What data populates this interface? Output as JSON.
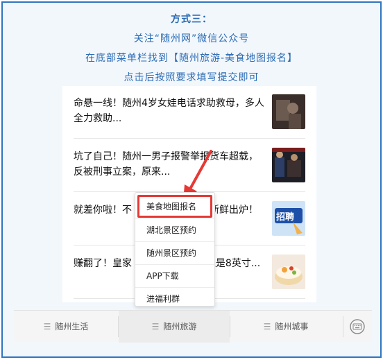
{
  "instructions": {
    "title": "方式三：",
    "line1": "关注“随州网”微信公众号",
    "line2": "在底部菜单栏找到【随州旅游-美食地图报名】",
    "line3": "点击后按照要求填写提交即可"
  },
  "articles": [
    {
      "headline": "命悬一线！随州4岁女娃电话求助救母，多人全力救助...",
      "thumb_icon": "photo-thumbnail-icon"
    },
    {
      "headline": "坑了自己！随州一男子报警举报货车超载，反被刑事立案，原来...",
      "thumb_icon": "police-photo-icon"
    },
    {
      "headline": "就差你啦！不",
      "headline_tail": "岗位新鲜出炉！",
      "thumb_icon": "recruitment-banner-icon",
      "thumb_text": "招聘"
    },
    {
      "headline": "赚翻了！皇家",
      "headline_tail": "9？还是8英寸...",
      "thumb_icon": "cake-photo-icon"
    }
  ],
  "popup_menu": {
    "items": [
      "美食地图报名",
      "湖北景区预约",
      "随州景区预约",
      "APP下载",
      "进福利群"
    ],
    "highlighted_index": 0
  },
  "bottom_menu": {
    "tabs": [
      "随州生活",
      "随州旅游",
      "随州城事"
    ],
    "active_index": 1,
    "keyboard_icon": "keyboard-icon"
  },
  "colors": {
    "frame_border": "#2f75bf",
    "instruction_text": "#2a6bb3",
    "highlight": "#e53935"
  }
}
